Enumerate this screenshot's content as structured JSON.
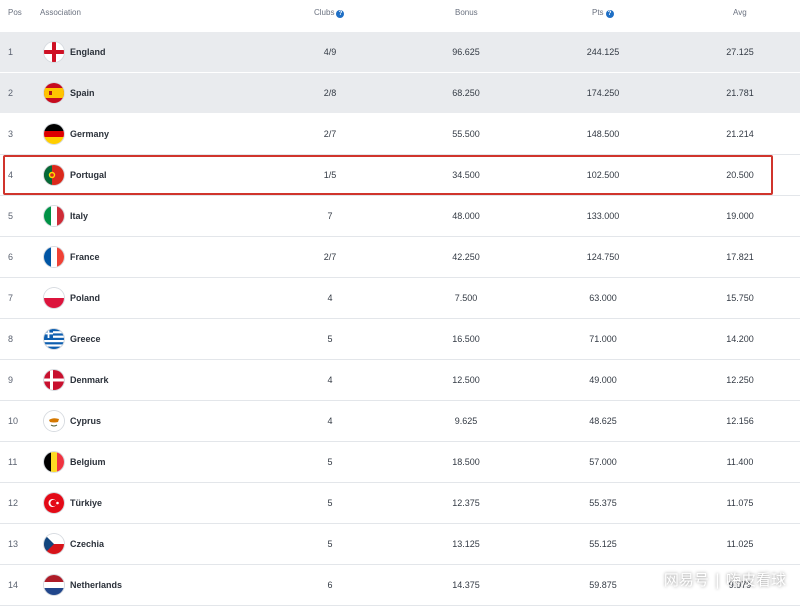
{
  "header": {
    "pos": "Pos",
    "association": "Association",
    "clubs": "Clubs",
    "bonus": "Bonus",
    "pts": "Pts",
    "avg": "Avg"
  },
  "rows": [
    {
      "pos": "1",
      "name": "England",
      "clubs": "4/9",
      "bonus": "96.625",
      "pts": "244.125",
      "avg": "27.125",
      "flag": "england-flag-icon"
    },
    {
      "pos": "2",
      "name": "Spain",
      "clubs": "2/8",
      "bonus": "68.250",
      "pts": "174.250",
      "avg": "21.781",
      "flag": "spain-flag-icon"
    },
    {
      "pos": "3",
      "name": "Germany",
      "clubs": "2/7",
      "bonus": "55.500",
      "pts": "148.500",
      "avg": "21.214",
      "flag": "germany-flag-icon"
    },
    {
      "pos": "4",
      "name": "Portugal",
      "clubs": "1/5",
      "bonus": "34.500",
      "pts": "102.500",
      "avg": "20.500",
      "flag": "portugal-flag-icon"
    },
    {
      "pos": "5",
      "name": "Italy",
      "clubs": "7",
      "bonus": "48.000",
      "pts": "133.000",
      "avg": "19.000",
      "flag": "italy-flag-icon"
    },
    {
      "pos": "6",
      "name": "France",
      "clubs": "2/7",
      "bonus": "42.250",
      "pts": "124.750",
      "avg": "17.821",
      "flag": "france-flag-icon"
    },
    {
      "pos": "7",
      "name": "Poland",
      "clubs": "4",
      "bonus": "7.500",
      "pts": "63.000",
      "avg": "15.750",
      "flag": "poland-flag-icon"
    },
    {
      "pos": "8",
      "name": "Greece",
      "clubs": "5",
      "bonus": "16.500",
      "pts": "71.000",
      "avg": "14.200",
      "flag": "greece-flag-icon"
    },
    {
      "pos": "9",
      "name": "Denmark",
      "clubs": "4",
      "bonus": "12.500",
      "pts": "49.000",
      "avg": "12.250",
      "flag": "denmark-flag-icon"
    },
    {
      "pos": "10",
      "name": "Cyprus",
      "clubs": "4",
      "bonus": "9.625",
      "pts": "48.625",
      "avg": "12.156",
      "flag": "cyprus-flag-icon"
    },
    {
      "pos": "11",
      "name": "Belgium",
      "clubs": "5",
      "bonus": "18.500",
      "pts": "57.000",
      "avg": "11.400",
      "flag": "belgium-flag-icon"
    },
    {
      "pos": "12",
      "name": "Türkiye",
      "clubs": "5",
      "bonus": "12.375",
      "pts": "55.375",
      "avg": "11.075",
      "flag": "turkiye-flag-icon"
    },
    {
      "pos": "13",
      "name": "Czechia",
      "clubs": "5",
      "bonus": "13.125",
      "pts": "55.125",
      "avg": "11.025",
      "flag": "czechia-flag-icon"
    },
    {
      "pos": "14",
      "name": "Netherlands",
      "clubs": "6",
      "bonus": "14.375",
      "pts": "59.875",
      "avg": "9.979",
      "flag": "netherlands-flag-icon"
    }
  ],
  "watermark": {
    "left": "网易号",
    "right": "嗨皮看球"
  },
  "colors": {
    "highlight": "#d0342c",
    "shade": "#e9ebee",
    "info_icon": "#1f6fc5"
  }
}
